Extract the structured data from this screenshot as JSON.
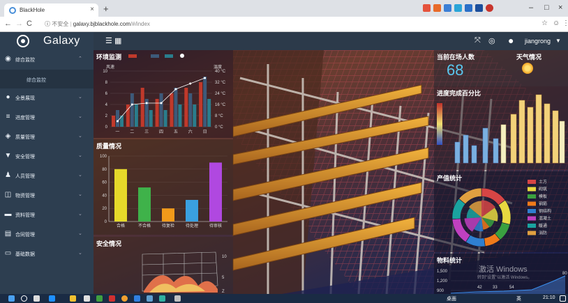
{
  "browser": {
    "tab_title": "BlackHole",
    "tab_close": "×",
    "new_tab": "+",
    "url_insecure": "不安全",
    "url_host": "galaxy.bjblackhole.com",
    "url_path": "/#/index",
    "back": "←",
    "forward": "→",
    "reload": "C",
    "star": "☆",
    "win_min": "–",
    "win_max": "□",
    "win_close": "×"
  },
  "app": {
    "logo": "Galaxy",
    "user": "jiangrong"
  },
  "sidebar": {
    "items": [
      {
        "label": "综合监控",
        "icon": "dashboard-icon",
        "glyph": "◉",
        "expanded": true
      },
      {
        "label": "全景展现",
        "icon": "globe-icon",
        "glyph": "●"
      },
      {
        "label": "进度管理",
        "icon": "list-icon",
        "glyph": "≡"
      },
      {
        "label": "质量管理",
        "icon": "shield-icon",
        "glyph": "◈"
      },
      {
        "label": "安全管理",
        "icon": "shield-check-icon",
        "glyph": "▼"
      },
      {
        "label": "人员管理",
        "icon": "person-icon",
        "glyph": "♟"
      },
      {
        "label": "物资管理",
        "icon": "truck-icon",
        "glyph": "◫"
      },
      {
        "label": "资料管理",
        "icon": "folder-icon",
        "glyph": "▬"
      },
      {
        "label": "合同管理",
        "icon": "document-icon",
        "glyph": "▤"
      },
      {
        "label": "基础数据",
        "icon": "monitor-icon",
        "glyph": "▭"
      }
    ],
    "sub_items": [
      "综合监控"
    ],
    "chevron": "⌃",
    "chevron_down": "⌄"
  },
  "panels": {
    "env": {
      "title": "环境监测",
      "left_axis": "风速",
      "right_axis": "温度"
    },
    "quality": {
      "title": "质量情况"
    },
    "safety": {
      "title": "安全情况"
    },
    "people": {
      "title": "当前在场人数",
      "value": "68"
    },
    "weather": {
      "title": "天气情况"
    },
    "progress": {
      "title": "进度完成百分比"
    },
    "output": {
      "title": "产值统计"
    },
    "materials": {
      "title": "物料统计"
    }
  },
  "chart_data": [
    {
      "type": "bar",
      "title": "环境监测",
      "categories": [
        "一",
        "二",
        "三",
        "四",
        "五",
        "六",
        "日"
      ],
      "series": [
        {
          "values": [
            2,
            4,
            7,
            5,
            6,
            7,
            8
          ],
          "color": "#c0392b"
        },
        {
          "values": [
            3,
            6,
            5,
            6,
            7,
            6,
            9
          ],
          "color": "#3d5a7a"
        },
        {
          "values": [
            2,
            4,
            3,
            3,
            4,
            4,
            5
          ],
          "color": "#2a7d8c"
        }
      ],
      "line": {
        "values": [
          4,
          16,
          17,
          17,
          27,
          31,
          35
        ],
        "color": "#ffffff"
      },
      "ylim": [
        0,
        10
      ],
      "y2lim": [
        0,
        40
      ],
      "yticks": [
        "0",
        "2",
        "4",
        "6",
        "8",
        "10"
      ],
      "y2ticks": [
        "0 °C",
        "8 °C",
        "16 °C",
        "24 °C",
        "32 °C",
        "40 °C"
      ],
      "xlabel": "风速",
      "ylabel": "温度"
    },
    {
      "type": "bar",
      "title": "质量情况",
      "categories": [
        "合格",
        "不合格",
        "待复检",
        "待处理",
        "待审核"
      ],
      "values": [
        80,
        52,
        20,
        33,
        90
      ],
      "colors": [
        "#e6d92a",
        "#3fb24a",
        "#f29a1a",
        "#3aa0e0",
        "#b048e0"
      ],
      "ylim": [
        0,
        100
      ],
      "yticks": [
        "0",
        "20",
        "40",
        "60",
        "80",
        "100"
      ]
    },
    {
      "type": "pie",
      "title": "产值统计",
      "categories": [
        "土方",
        "砌筑",
        "模板",
        "钢筋",
        "钢结构",
        "混凝土",
        "暖通",
        "消防"
      ],
      "values": [
        15,
        14,
        10,
        9,
        11,
        15,
        12,
        14
      ],
      "colors": [
        "#d64545",
        "#e8d840",
        "#3aa040",
        "#f07a1a",
        "#2f7fd0",
        "#c040c0",
        "#1aa3a0",
        "#e0a040"
      ]
    },
    {
      "type": "line",
      "title": "物料统计",
      "yticks": [
        "1,500",
        "1,200",
        "900"
      ],
      "labels": [
        "42",
        "33",
        "54",
        "80"
      ]
    }
  ],
  "watermark": {
    "line1": "激活 Windows",
    "line2": "转到\"设置\"以激活 Windows。"
  },
  "taskbar": {
    "time": "21:10",
    "lang": "英",
    "desktop": "桌面"
  },
  "colors": {
    "sidebar_bg": "#2d3e50",
    "topbar_bg": "#2c3a4a",
    "accent": "#4ab0e0",
    "people_value": "#5ac8f0"
  }
}
